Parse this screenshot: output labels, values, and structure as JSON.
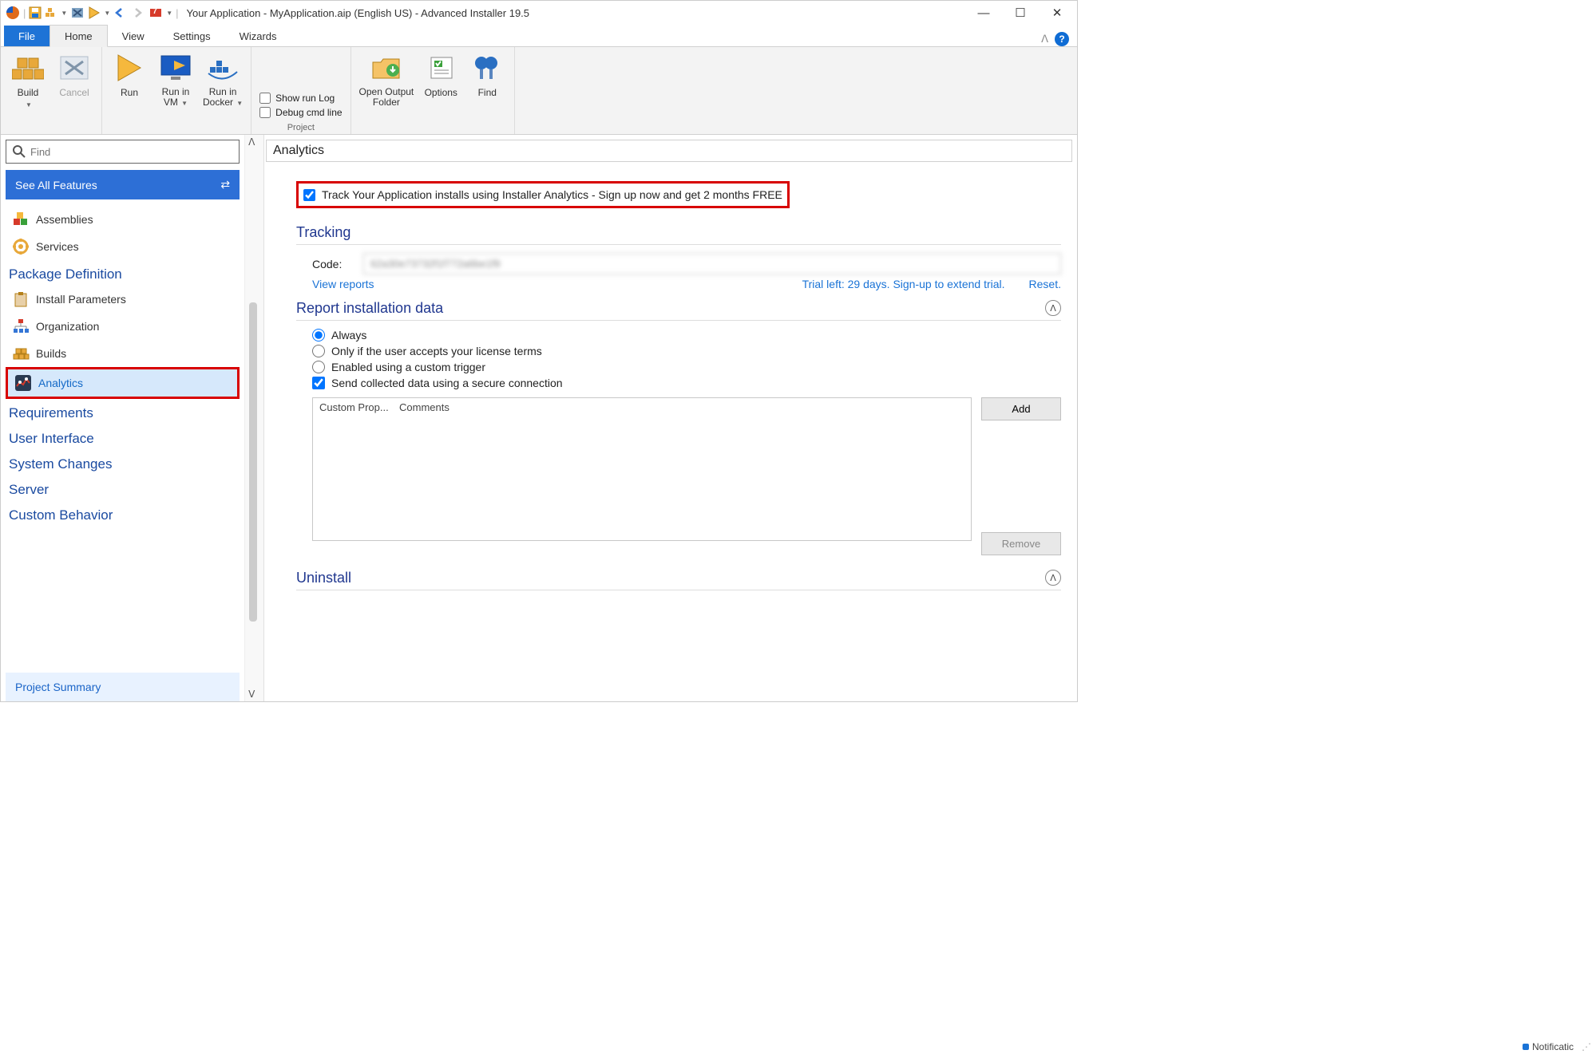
{
  "window": {
    "title": "Your Application - MyApplication.aip (English US) - Advanced Installer 19.5"
  },
  "qat_badge": "7",
  "ribbon_tabs": {
    "file": "File",
    "home": "Home",
    "view": "View",
    "settings": "Settings",
    "wizards": "Wizards"
  },
  "ribbon": {
    "build": "Build",
    "cancel": "Cancel",
    "run": "Run",
    "run_vm": "Run in\nVM",
    "run_docker": "Run in\nDocker",
    "show_run_log": "Show run Log",
    "debug_cmd": "Debug cmd line",
    "group_project": "Project",
    "open_output": "Open Output\nFolder",
    "options": "Options",
    "find": "Find"
  },
  "sidebar": {
    "find_placeholder": "Find",
    "see_all": "See All Features",
    "items": [
      {
        "label": "Assemblies"
      },
      {
        "label": "Services"
      }
    ],
    "pkg_def": "Package Definition",
    "pkg_items": [
      {
        "label": "Install Parameters"
      },
      {
        "label": "Organization"
      },
      {
        "label": "Builds"
      },
      {
        "label": "Analytics"
      }
    ],
    "requirements": "Requirements",
    "ui": "User Interface",
    "sys_changes": "System Changes",
    "server": "Server",
    "custom_behavior": "Custom Behavior",
    "project_summary": "Project Summary"
  },
  "content": {
    "title": "Analytics",
    "track_label": "Track Your Application installs using Installer Analytics - Sign up now and get 2 months FREE",
    "tracking_hdr": "Tracking",
    "code_label": "Code:",
    "code_value": "62a30e73732f1f772a6be1f9",
    "view_reports": "View reports",
    "trial_left": "Trial left: 29 days. Sign-up to extend trial.",
    "reset": "Reset.",
    "report_hdr": "Report installation data",
    "radio_always": "Always",
    "radio_license": "Only if the user accepts your license terms",
    "radio_trigger": "Enabled using a custom trigger",
    "check_secure": "Send collected data using a secure connection",
    "col_prop": "Custom Prop...",
    "col_comments": "Comments",
    "btn_add": "Add",
    "btn_remove": "Remove",
    "uninstall_hdr": "Uninstall"
  },
  "status": {
    "notif": "Notificatic"
  }
}
